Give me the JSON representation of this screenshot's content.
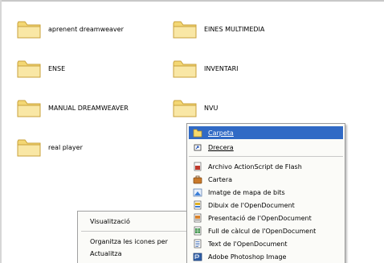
{
  "folders": [
    {
      "name": "aprenent dreamweaver"
    },
    {
      "name": "EINES MULTIMEDIA"
    },
    {
      "name": "ENSE"
    },
    {
      "name": "INVENTARI"
    },
    {
      "name": "MANUAL DREAMWEAVER"
    },
    {
      "name": "NVU"
    },
    {
      "name": "real player"
    }
  ],
  "context_menu": {
    "items": [
      {
        "label": "Visualització",
        "has_submenu": true
      },
      {
        "label": "Organitza les icones per",
        "has_submenu": true
      },
      {
        "label": "Actualitza",
        "has_submenu": false
      }
    ]
  },
  "new_submenu": {
    "items": [
      {
        "label": "Carpeta",
        "icon": "folder-icon",
        "highlighted": true
      },
      {
        "label": "Drecera",
        "icon": "shortcut-icon",
        "highlighted": false
      },
      {
        "label": "Archivo ActionScript de Flash",
        "icon": "actionscript-file-icon",
        "highlighted": false
      },
      {
        "label": "Cartera",
        "icon": "briefcase-icon",
        "highlighted": false
      },
      {
        "label": "Imatge de mapa de bits",
        "icon": "bitmap-image-icon",
        "highlighted": false
      },
      {
        "label": "Dibuix de l'OpenDocument",
        "icon": "opendocument-drawing-icon",
        "highlighted": false
      },
      {
        "label": "Presentació de l'OpenDocument",
        "icon": "opendocument-presentation-icon",
        "highlighted": false
      },
      {
        "label": "Full de càlcul de l'OpenDocument",
        "icon": "opendocument-spreadsheet-icon",
        "highlighted": false
      },
      {
        "label": "Text de l'OpenDocument",
        "icon": "opendocument-text-icon",
        "highlighted": false
      },
      {
        "label": "Adobe Photoshop Image",
        "icon": "photoshop-image-icon",
        "highlighted": false
      }
    ]
  },
  "colors": {
    "highlight": "#316ac5",
    "folder_fill": "#f7e29a",
    "menu_bg": "#fbfbf8"
  }
}
